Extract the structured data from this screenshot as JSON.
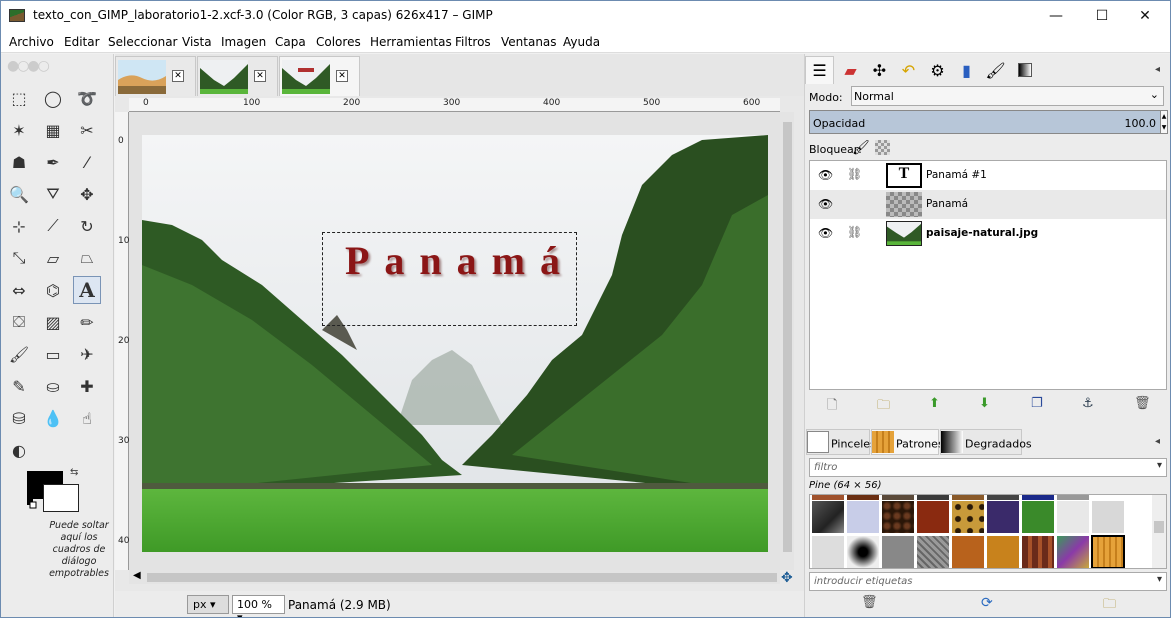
{
  "window": {
    "title": "texto_con_GIMP_laboratorio1-2.xcf-3.0 (Color RGB, 3 capas) 626x417 – GIMP",
    "minimize": "—",
    "maximize": "☐",
    "close": "✕"
  },
  "menu": [
    "Archivo",
    "Editar",
    "Seleccionar",
    "Vista",
    "Imagen",
    "Capa",
    "Colores",
    "Herramientas",
    "Filtros",
    "Ventanas",
    "Ayuda"
  ],
  "toolbox": {
    "tools": [
      {
        "name": "rect-select",
        "glyph": "⬚"
      },
      {
        "name": "ellipse-select",
        "glyph": "◯"
      },
      {
        "name": "free-select",
        "glyph": "➰"
      },
      {
        "name": "fuzzy-select",
        "glyph": "✶"
      },
      {
        "name": "select-by-color",
        "glyph": "▦"
      },
      {
        "name": "scissors-select",
        "glyph": "✂"
      },
      {
        "name": "foreground-select",
        "glyph": "☗"
      },
      {
        "name": "paths",
        "glyph": "✒"
      },
      {
        "name": "color-picker",
        "glyph": "⁄"
      },
      {
        "name": "zoom",
        "glyph": "🔍"
      },
      {
        "name": "measure",
        "glyph": "⛛"
      },
      {
        "name": "move",
        "glyph": "✥"
      },
      {
        "name": "align",
        "glyph": "⊹"
      },
      {
        "name": "crop",
        "glyph": "⟋"
      },
      {
        "name": "rotate",
        "glyph": "↻"
      },
      {
        "name": "scale",
        "glyph": "⤡"
      },
      {
        "name": "shear",
        "glyph": "▱"
      },
      {
        "name": "perspective",
        "glyph": "⏢"
      },
      {
        "name": "flip",
        "glyph": "⇔"
      },
      {
        "name": "cage-transform",
        "glyph": "⌬"
      },
      {
        "name": "text",
        "glyph": "A"
      },
      {
        "name": "bucket-fill",
        "glyph": "⛋"
      },
      {
        "name": "blend",
        "glyph": "▨"
      },
      {
        "name": "pencil",
        "glyph": "✏"
      },
      {
        "name": "paintbrush",
        "glyph": "🖌"
      },
      {
        "name": "eraser",
        "glyph": "▭"
      },
      {
        "name": "airbrush",
        "glyph": "✈"
      },
      {
        "name": "ink",
        "glyph": "✎"
      },
      {
        "name": "clone",
        "glyph": "⛀"
      },
      {
        "name": "heal",
        "glyph": "✚"
      },
      {
        "name": "perspective-clone",
        "glyph": "⛁"
      },
      {
        "name": "blur-sharpen",
        "glyph": "💧"
      },
      {
        "name": "smudge",
        "glyph": "☝"
      },
      {
        "name": "dodge-burn",
        "glyph": "◐"
      }
    ],
    "fg_color": "#000000",
    "bg_color": "#ffffff",
    "drop_hint": "Puede soltar aquí los cuadros de diálogo empotrables"
  },
  "image_tabs": [
    {
      "name": "tab-image-1"
    },
    {
      "name": "tab-image-2"
    },
    {
      "name": "tab-image-3",
      "active": true
    }
  ],
  "rulers": {
    "h": [
      "0",
      "100",
      "200",
      "300",
      "400",
      "500",
      "600"
    ],
    "v": [
      "0",
      "100",
      "200",
      "300",
      "400"
    ]
  },
  "canvas": {
    "text": "Panamá"
  },
  "status": {
    "unit": "px",
    "zoom": "100 %",
    "text": "Panamá (2.9 MB)"
  },
  "layers_panel": {
    "mode_label": "Modo:",
    "mode_value": "Normal",
    "opacity_label": "Opacidad",
    "opacity_value": "100.0",
    "lock_label": "Bloquear:",
    "layers": [
      {
        "name": "Panamá #1",
        "bold": false,
        "highlight": false,
        "thumb": "text"
      },
      {
        "name": "Panamá",
        "bold": false,
        "highlight": true,
        "thumb": "transparent"
      },
      {
        "name": "paisaje-natural.jpg",
        "bold": true,
        "highlight": false,
        "thumb": "photo"
      }
    ]
  },
  "resources": {
    "tabs": [
      "Pinceles",
      "Patrones",
      "Degradados"
    ],
    "filter_placeholder": "filtro",
    "pattern_name": "Pine (64 × 56)",
    "tags_placeholder": "introducir etiquetas"
  },
  "colors": {
    "accent": "#b7c6d8",
    "text_red": "#8b1616"
  }
}
